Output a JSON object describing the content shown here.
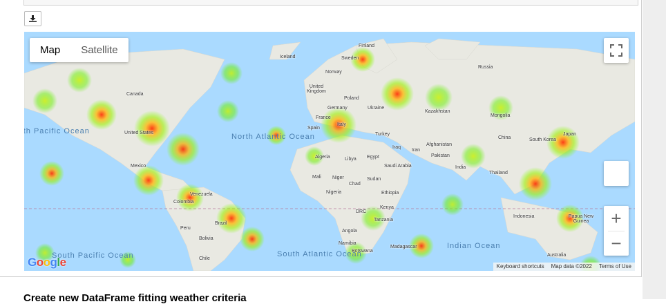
{
  "toolbar": {
    "download_icon": "download-icon"
  },
  "map": {
    "type_control": {
      "map_label": "Map",
      "satellite_label": "Satellite",
      "selected": "Map"
    },
    "controls": {
      "fullscreen_icon": "fullscreen-icon",
      "zoom_in_label": "+",
      "zoom_out_label": "−"
    },
    "countries": [
      "Finland",
      "Sweden",
      "Norway",
      "Iceland",
      "Russia",
      "United Kingdom",
      "Poland",
      "Germany",
      "Ukraine",
      "France",
      "Italy",
      "Spain",
      "Kazakhstan",
      "Mongolia",
      "Canada",
      "United States",
      "Mexico",
      "Turkey",
      "Iraq",
      "Iran",
      "Afghanistan",
      "Pakistan",
      "China",
      "South Korea",
      "Japan",
      "Algeria",
      "Libya",
      "Egypt",
      "Saudi Arabia",
      "India",
      "Thailand",
      "Mali",
      "Niger",
      "Chad",
      "Sudan",
      "Nigeria",
      "Ethiopia",
      "Venezuela",
      "Colombia",
      "DRC",
      "Kenya",
      "Tanzania",
      "Peru",
      "Brazil",
      "Bolivia",
      "Angola",
      "Namibia",
      "Botswana",
      "Madagascar",
      "Indonesia",
      "Papua New Guinea",
      "Chile",
      "Australia"
    ],
    "oceans": [
      "North Atlantic Ocean",
      "South Atlantic Ocean",
      "Indian Ocean",
      "North Pacific Ocean",
      "South Pacific Ocean"
    ],
    "attribution": {
      "keyboard": "Keyboard shortcuts",
      "data": "Map data ©2022",
      "terms": "Terms of Use"
    },
    "logo": "Google"
  },
  "next_section": {
    "heading": "Create new DataFrame fitting weather criteria"
  }
}
